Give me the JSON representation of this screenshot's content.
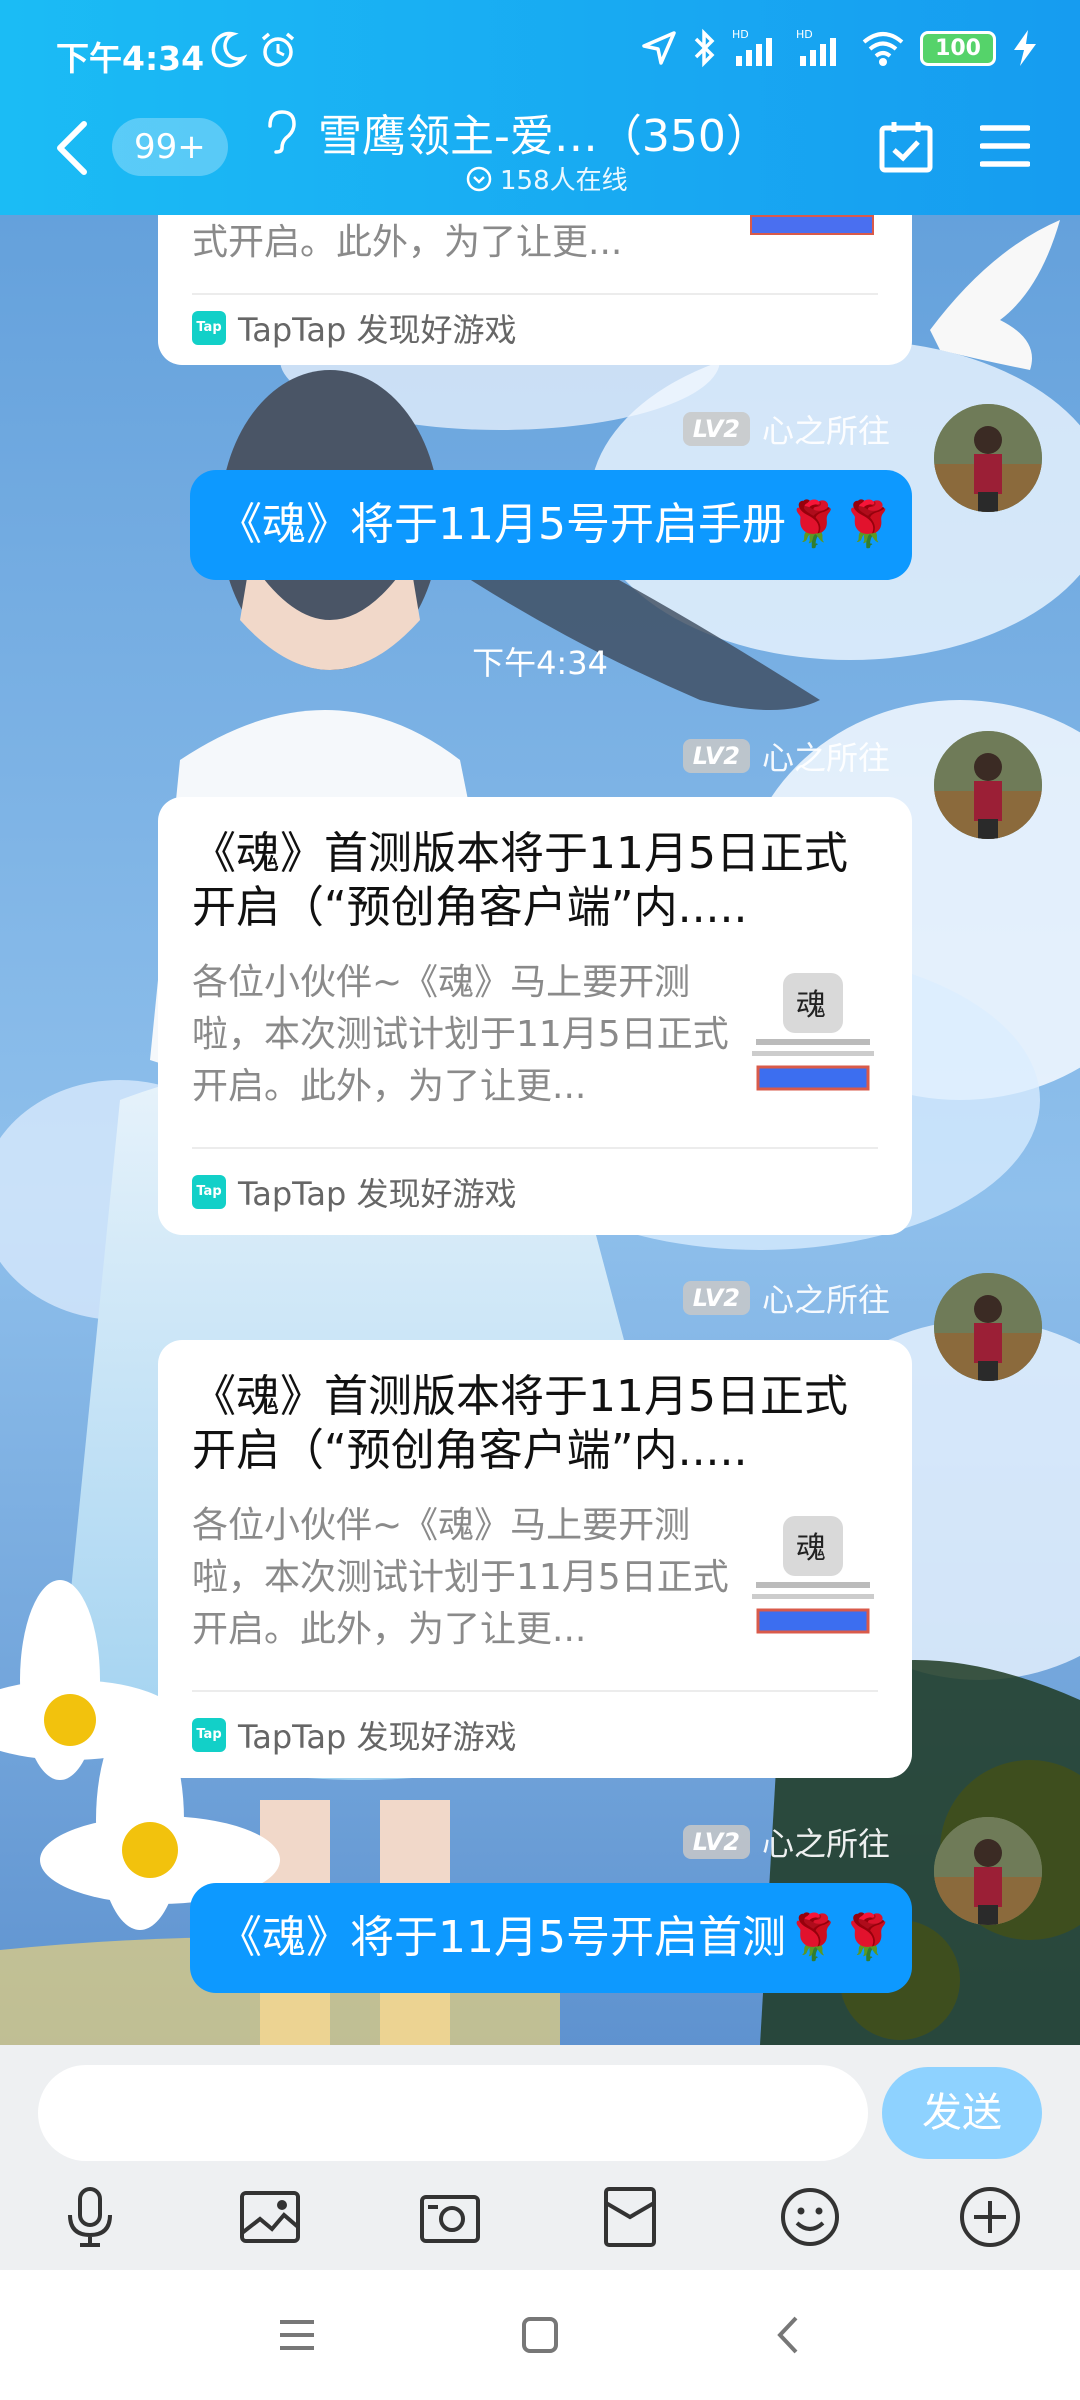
{
  "status_bar": {
    "time": "下午4:34",
    "battery": "100"
  },
  "header": {
    "unread_badge": "99+",
    "title": "雪鹰领主-爱…（350）",
    "online": "158人在线"
  },
  "messages": [
    {
      "type": "card_partial",
      "desc_tail": "式开启。此外，为了让更...",
      "source": "TapTap 发现好游戏"
    },
    {
      "type": "text",
      "level": "LV2",
      "sender": "心之所往",
      "text": "《魂》将于11月5号开启手册🌹🌹"
    },
    {
      "type": "timestamp",
      "text": "下午4:34"
    },
    {
      "type": "card",
      "level": "LV2",
      "sender": "心之所往",
      "title": "《魂》首测版本将于11月5日正式开启（“预创角客户端”内.....",
      "desc": "各位小伙伴~《魂》马上要开测啦，本次测试计划于11月5日正式开启。此外，为了让更...",
      "source": "TapTap 发现好游戏"
    },
    {
      "type": "card",
      "level": "LV2",
      "sender": "心之所往",
      "title": "《魂》首测版本将于11月5日正式开启（“预创角客户端”内.....",
      "desc": "各位小伙伴~《魂》马上要开测啦，本次测试计划于11月5日正式开启。此外，为了让更...",
      "source": "TapTap 发现好游戏"
    },
    {
      "type": "text",
      "level": "LV2",
      "sender": "心之所往",
      "text": "《魂》将于11月5号开启首测🌹🌹"
    }
  ],
  "input": {
    "placeholder": "",
    "send_label": "发送"
  },
  "toolbar": {
    "icons": [
      "microphone-icon",
      "image-icon",
      "camera-icon",
      "red-packet-icon",
      "emoji-icon",
      "plus-icon"
    ]
  },
  "colors": {
    "header": "#169cf0",
    "bubble": "#0d99ff",
    "send": "#8ed2ff"
  }
}
